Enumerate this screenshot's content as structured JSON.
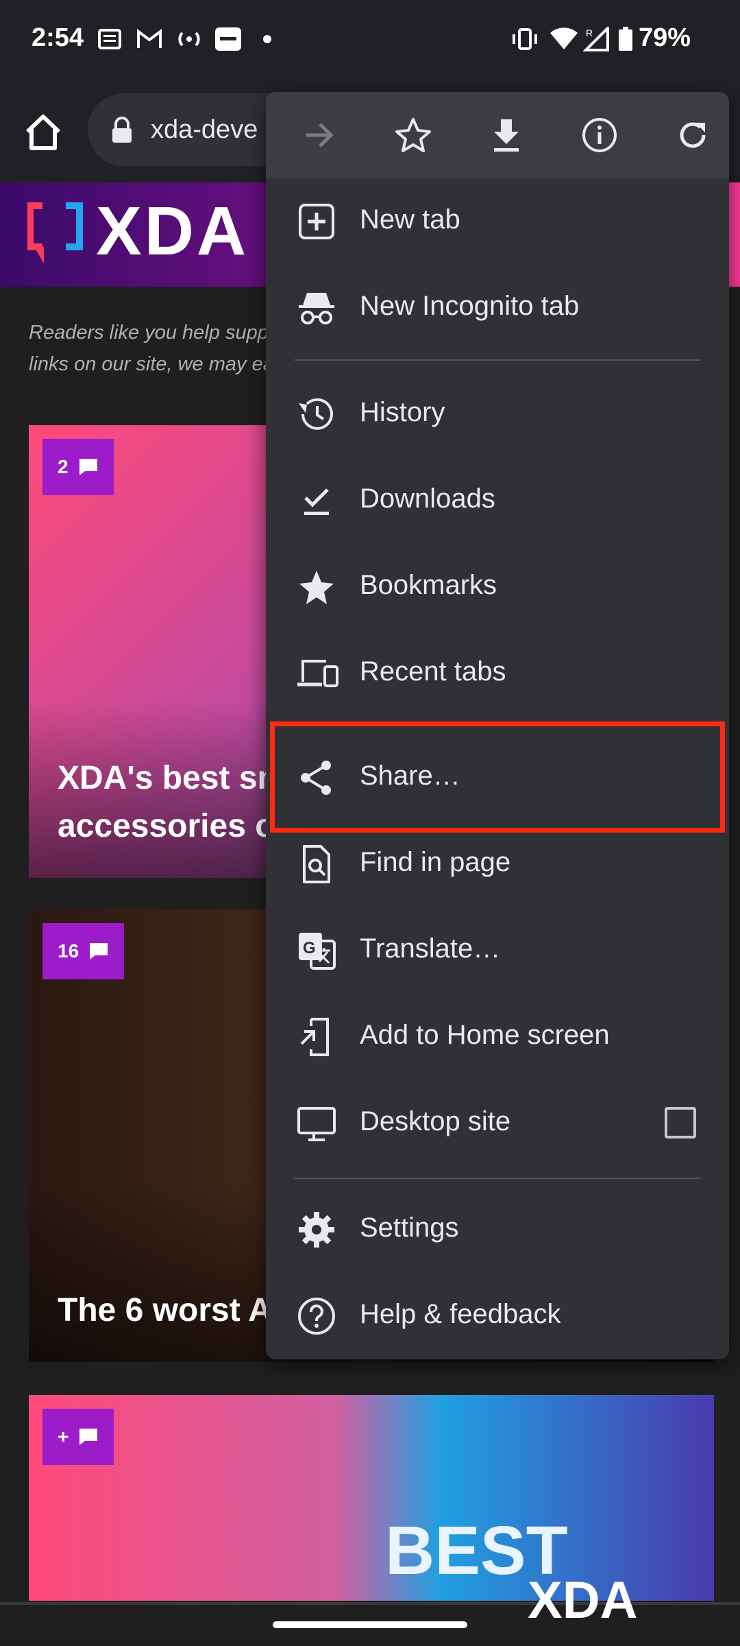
{
  "status_bar": {
    "time": "2:54",
    "battery": "79%",
    "signal_label": "R"
  },
  "toolbar": {
    "url": "xda-deve"
  },
  "page": {
    "logo": "XDA",
    "disclaimer_line1": "Readers like you help suppo",
    "disclaimer_line2": "links on our site, we may ea",
    "cards": [
      {
        "comments": "2",
        "title_line1": "XDA's best sm",
        "title_line2": "accessories o"
      },
      {
        "comments": "16",
        "title_line1": "The 6 worst A",
        "title_line2": ""
      },
      {
        "comments": "+",
        "overlay_text": "BEST"
      }
    ],
    "watermark": "XDA"
  },
  "menu": {
    "items": [
      {
        "label": "New tab",
        "icon": "plus-box-icon"
      },
      {
        "label": "New Incognito tab",
        "icon": "incognito-icon"
      },
      {
        "label": "History",
        "icon": "history-icon"
      },
      {
        "label": "Downloads",
        "icon": "download-check-icon"
      },
      {
        "label": "Bookmarks",
        "icon": "star-filled-icon"
      },
      {
        "label": "Recent tabs",
        "icon": "devices-icon"
      },
      {
        "label": "Share…",
        "icon": "share-icon"
      },
      {
        "label": "Find in page",
        "icon": "find-in-page-icon"
      },
      {
        "label": "Translate…",
        "icon": "translate-icon"
      },
      {
        "label": "Add to Home screen",
        "icon": "add-to-home-icon"
      },
      {
        "label": "Desktop site",
        "icon": "monitor-icon"
      },
      {
        "label": "Settings",
        "icon": "gear-icon"
      },
      {
        "label": "Help & feedback",
        "icon": "help-icon"
      }
    ]
  },
  "colors": {
    "highlight": "#ff2a14",
    "menu_bg": "#303134",
    "badge": "#9b1cc8"
  }
}
